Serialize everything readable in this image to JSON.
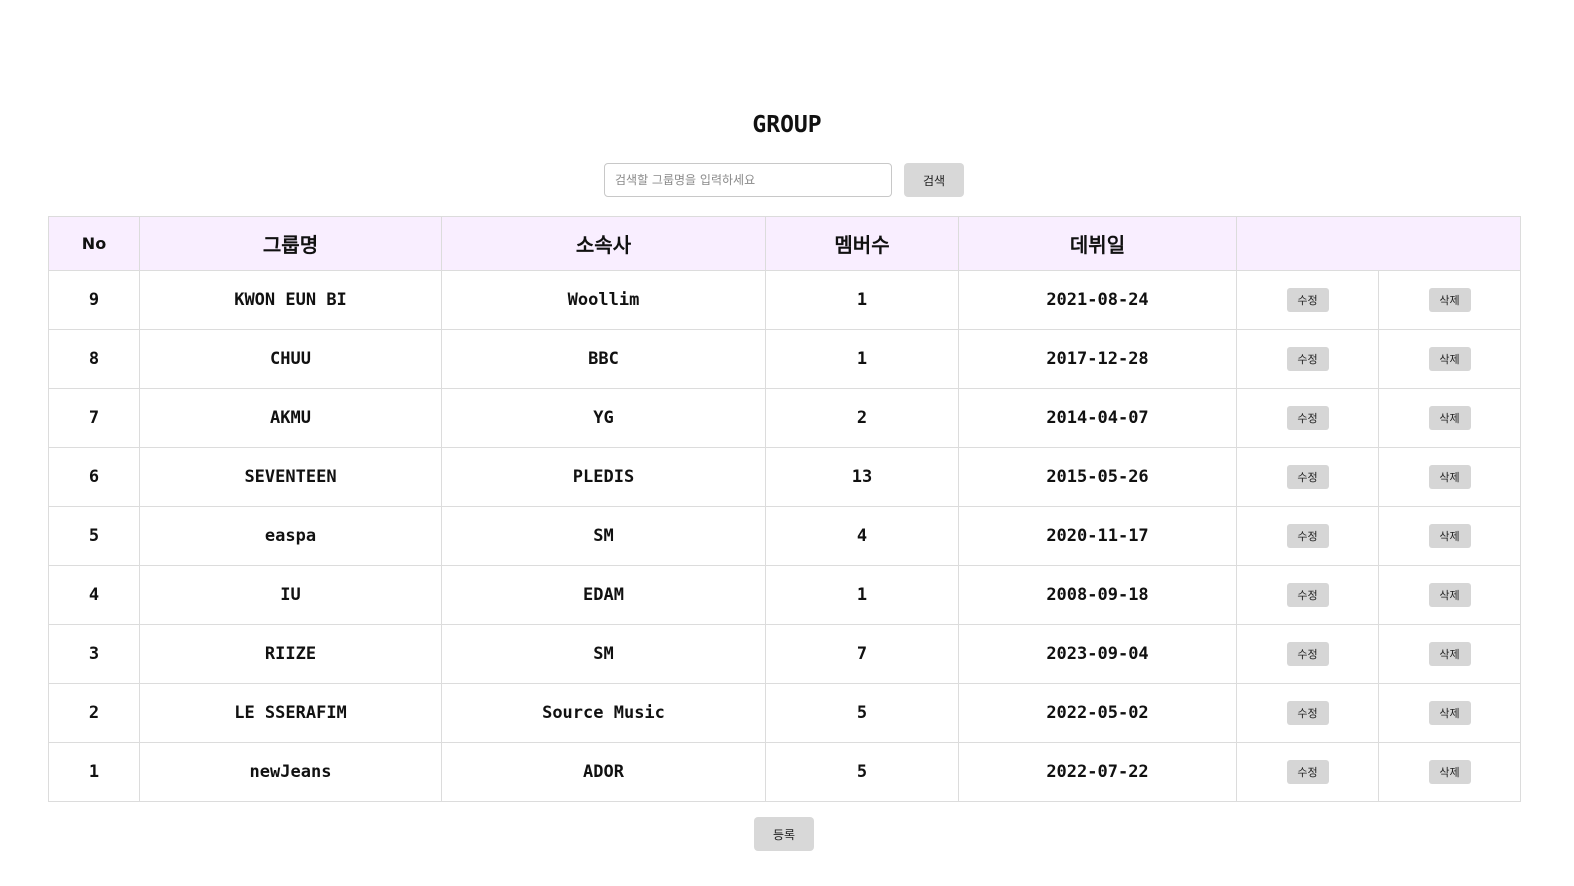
{
  "page": {
    "title": "GROUP"
  },
  "search": {
    "placeholder": "검색할 그룹명을 입력하세요",
    "value": "",
    "button_label": "검색"
  },
  "table": {
    "headers": {
      "no": "No",
      "group_name": "그룹명",
      "agency": "소속사",
      "member_count": "멤버수",
      "debut_date": "데뷔일",
      "actions": ""
    },
    "edit_label": "수정",
    "delete_label": "삭제",
    "rows": [
      {
        "no": "9",
        "group_name": "KWON EUN BI",
        "agency": "Woollim",
        "member_count": "1",
        "debut_date": "2021-08-24"
      },
      {
        "no": "8",
        "group_name": "CHUU",
        "agency": "BBC",
        "member_count": "1",
        "debut_date": "2017-12-28"
      },
      {
        "no": "7",
        "group_name": "AKMU",
        "agency": "YG",
        "member_count": "2",
        "debut_date": "2014-04-07"
      },
      {
        "no": "6",
        "group_name": "SEVENTEEN",
        "agency": "PLEDIS",
        "member_count": "13",
        "debut_date": "2015-05-26"
      },
      {
        "no": "5",
        "group_name": "easpa",
        "agency": "SM",
        "member_count": "4",
        "debut_date": "2020-11-17"
      },
      {
        "no": "4",
        "group_name": "IU",
        "agency": "EDAM",
        "member_count": "1",
        "debut_date": "2008-09-18"
      },
      {
        "no": "3",
        "group_name": "RIIZE",
        "agency": "SM",
        "member_count": "7",
        "debut_date": "2023-09-04"
      },
      {
        "no": "2",
        "group_name": "LE SSERAFIM",
        "agency": "Source Music",
        "member_count": "5",
        "debut_date": "2022-05-02"
      },
      {
        "no": "1",
        "group_name": "newJeans",
        "agency": "ADOR",
        "member_count": "5",
        "debut_date": "2022-07-22"
      }
    ]
  },
  "footer": {
    "register_label": "등록"
  },
  "colors": {
    "header_background": "#f9eeff",
    "button_background": "#d8d8d8",
    "border": "#dcdcdc"
  }
}
